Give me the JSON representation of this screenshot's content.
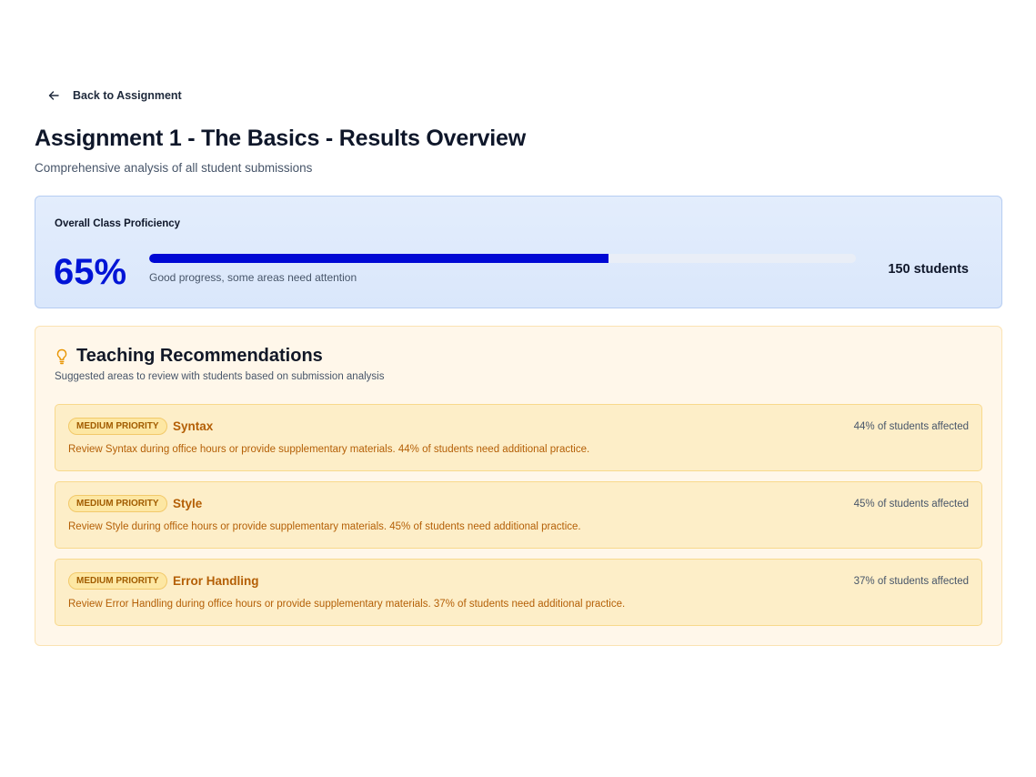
{
  "nav": {
    "back_label": "Back to Assignment",
    "back_icon": "arrow-left-icon"
  },
  "header": {
    "title": "Assignment 1 - The Basics - Results Overview",
    "subtitle": "Comprehensive analysis of all student submissions"
  },
  "proficiency": {
    "label": "Overall Class Proficiency",
    "percent_text": "65%",
    "progress_fraction": 0.65,
    "caption": "Good progress, some areas need attention",
    "students": "150 students",
    "accent_color": "#0014d6"
  },
  "recommendations": {
    "icon": "lightbulb-icon",
    "title": "Teaching Recommendations",
    "subtitle": "Suggested areas to review with students based on submission analysis",
    "items": [
      {
        "priority": "MEDIUM PRIORITY",
        "topic": "Syntax",
        "affected": "44% of students affected",
        "description": "Review Syntax during office hours or provide supplementary materials. 44% of students need additional practice."
      },
      {
        "priority": "MEDIUM PRIORITY",
        "topic": "Style",
        "affected": "45% of students affected",
        "description": "Review Style during office hours or provide supplementary materials. 45% of students need additional practice."
      },
      {
        "priority": "MEDIUM PRIORITY",
        "topic": "Error Handling",
        "affected": "37% of students affected",
        "description": "Review Error Handling during office hours or provide supplementary materials. 37% of students need additional practice."
      }
    ]
  }
}
